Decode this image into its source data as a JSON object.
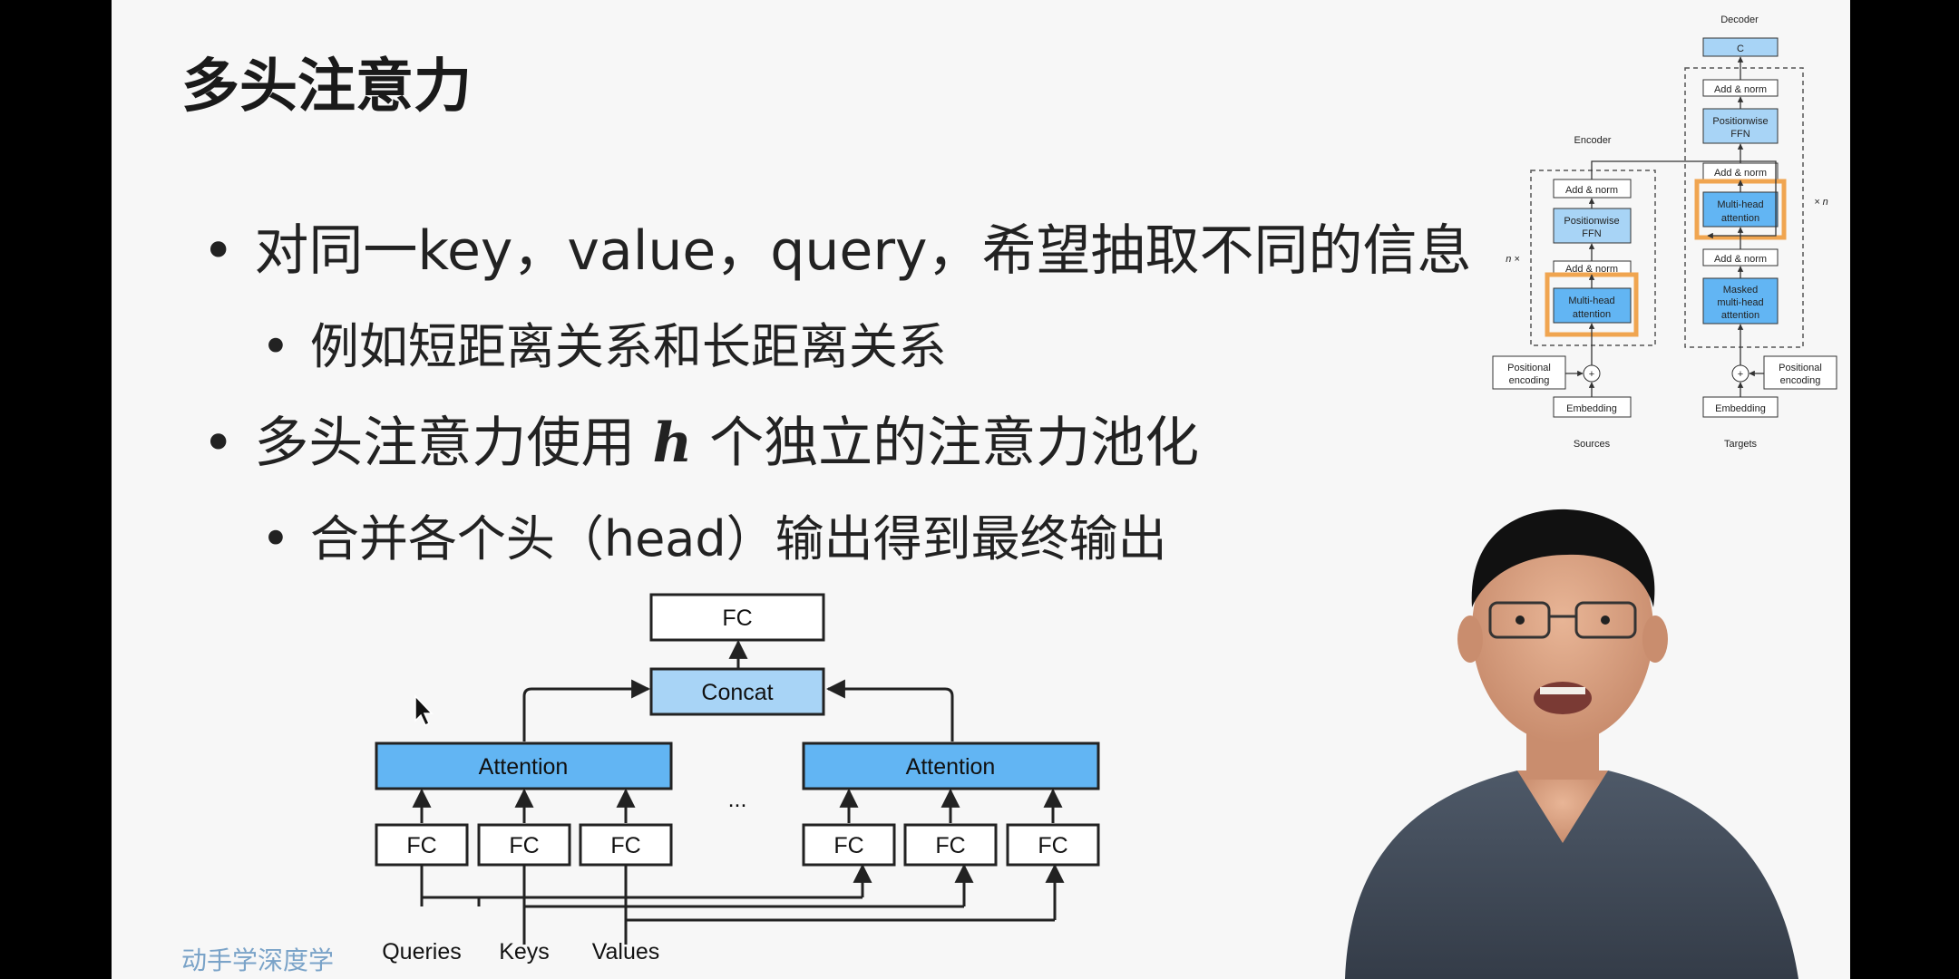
{
  "slide": {
    "title": "多头注意力",
    "bullets": {
      "b1": "对同一key，value，query，希望抽取不同的信息",
      "b1_sub": "例如短距离关系和长距离关系",
      "b2_pre": "多头注意力使用",
      "b2_var": "h",
      "b2_post": "个独立的注意力池化",
      "b2_sub": "合并各个头（head）输出得到最终输出"
    },
    "footer": "动手学深度学"
  },
  "multihead_diagram": {
    "fc_top": "FC",
    "concat": "Concat",
    "attention": "Attention",
    "fc": "FC",
    "ellipsis": "...",
    "queries": "Queries",
    "keys": "Keys",
    "values": "Values"
  },
  "transformer": {
    "encoder": "Encoder",
    "decoder": "Decoder",
    "add_norm": "Add & norm",
    "ffn_1": "Positionwise",
    "ffn_2": "FFN",
    "mha_1": "Multi-head",
    "mha_2": "attention",
    "masked_1": "Masked",
    "masked_2": "multi-head",
    "masked_3": "attention",
    "pos_1": "Positional",
    "pos_2": "encoding",
    "embedding": "Embedding",
    "sources": "Sources",
    "targets": "Targets",
    "n_left": "n ×",
    "n_right": "× n",
    "top_box": "C"
  },
  "colors": {
    "attention_blue": "#62b5f3",
    "concat_blue": "#a8d4f6",
    "highlight_orange": "#f0a550",
    "slide_bg": "#f7f7f7"
  }
}
